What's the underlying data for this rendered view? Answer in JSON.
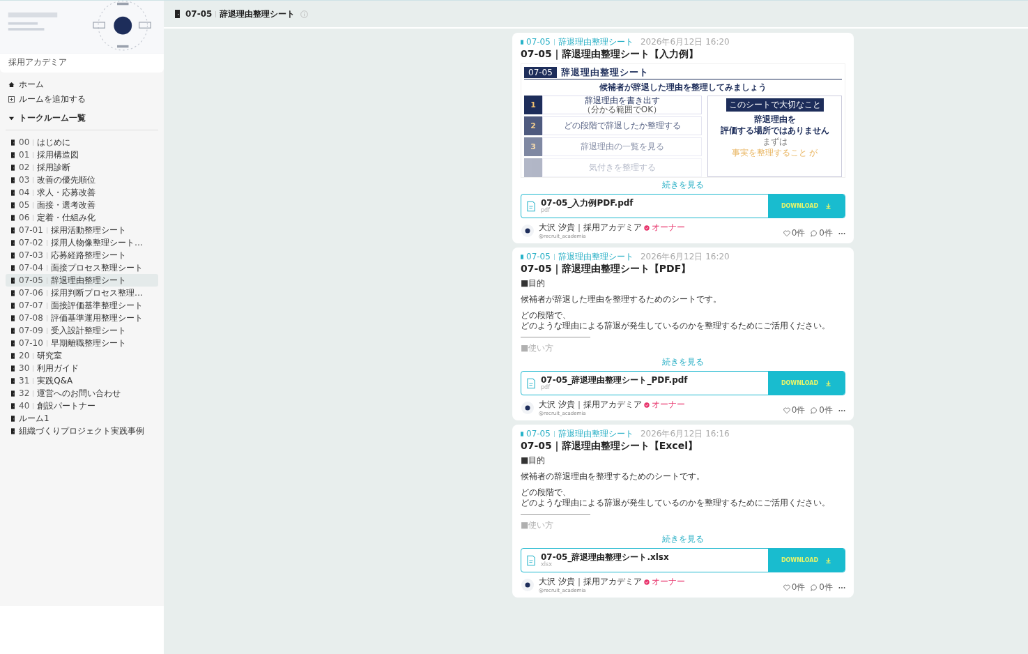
{
  "header": {
    "room_code": "07-05",
    "room_name": "辞退理由整理シート"
  },
  "sidebar": {
    "community_name": "採用アカデミア",
    "nav": [
      {
        "kind": "home",
        "label": "ホーム"
      },
      {
        "kind": "add",
        "label": "ルームを追加する"
      }
    ],
    "section": {
      "label": "トークルーム一覧",
      "expanded": true
    },
    "rooms": [
      {
        "code": "00",
        "name": "はじめに",
        "selected": false
      },
      {
        "code": "01",
        "name": "採用構造図",
        "selected": false
      },
      {
        "code": "02",
        "name": "採用診断",
        "selected": false
      },
      {
        "code": "03",
        "name": "改善の優先順位",
        "selected": false
      },
      {
        "code": "04",
        "name": "求人・応募改善",
        "selected": false
      },
      {
        "code": "05",
        "name": "面接・選考改善",
        "selected": false
      },
      {
        "code": "06",
        "name": "定着・仕組み化",
        "selected": false
      },
      {
        "code": "07-01",
        "name": "採用活動整理シート",
        "selected": false
      },
      {
        "code": "07-02",
        "name": "採用人物像整理シート…",
        "selected": false
      },
      {
        "code": "07-03",
        "name": "応募経路整理シート",
        "selected": false
      },
      {
        "code": "07-04",
        "name": "面接プロセス整理シート",
        "selected": false
      },
      {
        "code": "07-05",
        "name": "辞退理由整理シート",
        "selected": true
      },
      {
        "code": "07-06",
        "name": "採用判断プロセス整理…",
        "selected": false
      },
      {
        "code": "07-07",
        "name": "面接評価基準整理シート",
        "selected": false
      },
      {
        "code": "07-08",
        "name": "評価基準運用整理シート",
        "selected": false
      },
      {
        "code": "07-09",
        "name": "受入設計整理シート",
        "selected": false
      },
      {
        "code": "07-10",
        "name": "早期離職整理シート",
        "selected": false
      },
      {
        "code": "20",
        "name": "研究室",
        "selected": false
      },
      {
        "code": "30",
        "name": "利用ガイド",
        "selected": false
      },
      {
        "code": "31",
        "name": "実践Q&A",
        "selected": false
      },
      {
        "code": "32",
        "name": "運営へのお問い合わせ",
        "selected": false
      },
      {
        "code": "40",
        "name": "創設パートナー",
        "selected": false
      },
      {
        "name": "ルーム1",
        "selected": false
      },
      {
        "name": "組織づくりプロジェクト実践事例",
        "selected": false
      }
    ]
  },
  "posts": [
    {
      "room_code": "07-05",
      "room_name": "辞退理由整理シート",
      "date": "2026年6月12日 16:20",
      "title": "07-05｜辞退理由整理シート【入力例】",
      "body": {
        "kind": "preview",
        "sheet_code": "07-05",
        "sheet_title": "辞退理由整理シート",
        "lead": "候補者が辞退した理由を整理してみましょう",
        "steps": [
          {
            "number": "1",
            "title": "辞退理由を書き出す",
            "note": "（分かる範囲でOK）"
          },
          {
            "number": "2",
            "title": "どの段階で辞退したか整理する"
          },
          {
            "number": "3",
            "title": "辞退理由の一覧を見る"
          },
          {
            "title": "気付きを整理する"
          }
        ],
        "aside": {
          "heading": "このシートで大切なこと",
          "lines": [
            "辞退理由を",
            "評価する場所ではありません",
            "まずは",
            "事実を整理すること が"
          ]
        }
      },
      "more": "続きを見る",
      "file": {
        "name": "07-05_入力例PDF.pdf",
        "ext": "pdf"
      },
      "download": "DOWNLOAD",
      "author": "大沢 汐貴｜採用アカデミア",
      "badge": "オーナー",
      "handle": "@recruit_academia",
      "likes": "0件",
      "comments": "0件"
    },
    {
      "room_code": "07-05",
      "room_name": "辞退理由整理シート",
      "date": "2026年6月12日 16:20",
      "title": "07-05｜辞退理由整理シート【PDF】",
      "body": {
        "kind": "text",
        "blocks": [
          {
            "kind": "text",
            "lines": [
              "■目的"
            ]
          },
          {
            "kind": "text",
            "lines": [
              "候補者が辞退した理由を整理するためのシートです。"
            ]
          },
          {
            "kind": "text",
            "lines": [
              "どの段階で、",
              "どのような理由による辞退が発生しているのかを整理するためにご活用ください。"
            ]
          },
          {
            "kind": "rule"
          },
          {
            "kind": "faded",
            "lines": [
              "■使い方"
            ]
          }
        ]
      },
      "more": "続きを見る",
      "file": {
        "name": "07-05_辞退理由整理シート_PDF.pdf",
        "ext": "pdf"
      },
      "download": "DOWNLOAD",
      "author": "大沢 汐貴｜採用アカデミア",
      "badge": "オーナー",
      "handle": "@recruit_academia",
      "likes": "0件",
      "comments": "0件"
    },
    {
      "room_code": "07-05",
      "room_name": "辞退理由整理シート",
      "date": "2026年6月12日 16:16",
      "title": "07-05｜辞退理由整理シート【Excel】",
      "body": {
        "kind": "text",
        "blocks": [
          {
            "kind": "text",
            "lines": [
              "■目的"
            ]
          },
          {
            "kind": "text",
            "lines": [
              "候補者の辞退理由を整理するためのシートです。"
            ]
          },
          {
            "kind": "text",
            "lines": [
              "どの段階で、",
              "どのような理由による辞退が発生しているのかを整理するためにご活用ください。"
            ]
          },
          {
            "kind": "rule"
          },
          {
            "kind": "faded",
            "lines": [
              "■使い方"
            ]
          }
        ]
      },
      "more": "続きを見る",
      "file": {
        "name": "07-05_辞退理由整理シート.xlsx",
        "ext": "xlsx"
      },
      "download": "DOWNLOAD",
      "author": "大沢 汐貴｜採用アカデミア",
      "badge": "オーナー",
      "handle": "@recruit_academia",
      "likes": "0件",
      "comments": "0件"
    }
  ]
}
